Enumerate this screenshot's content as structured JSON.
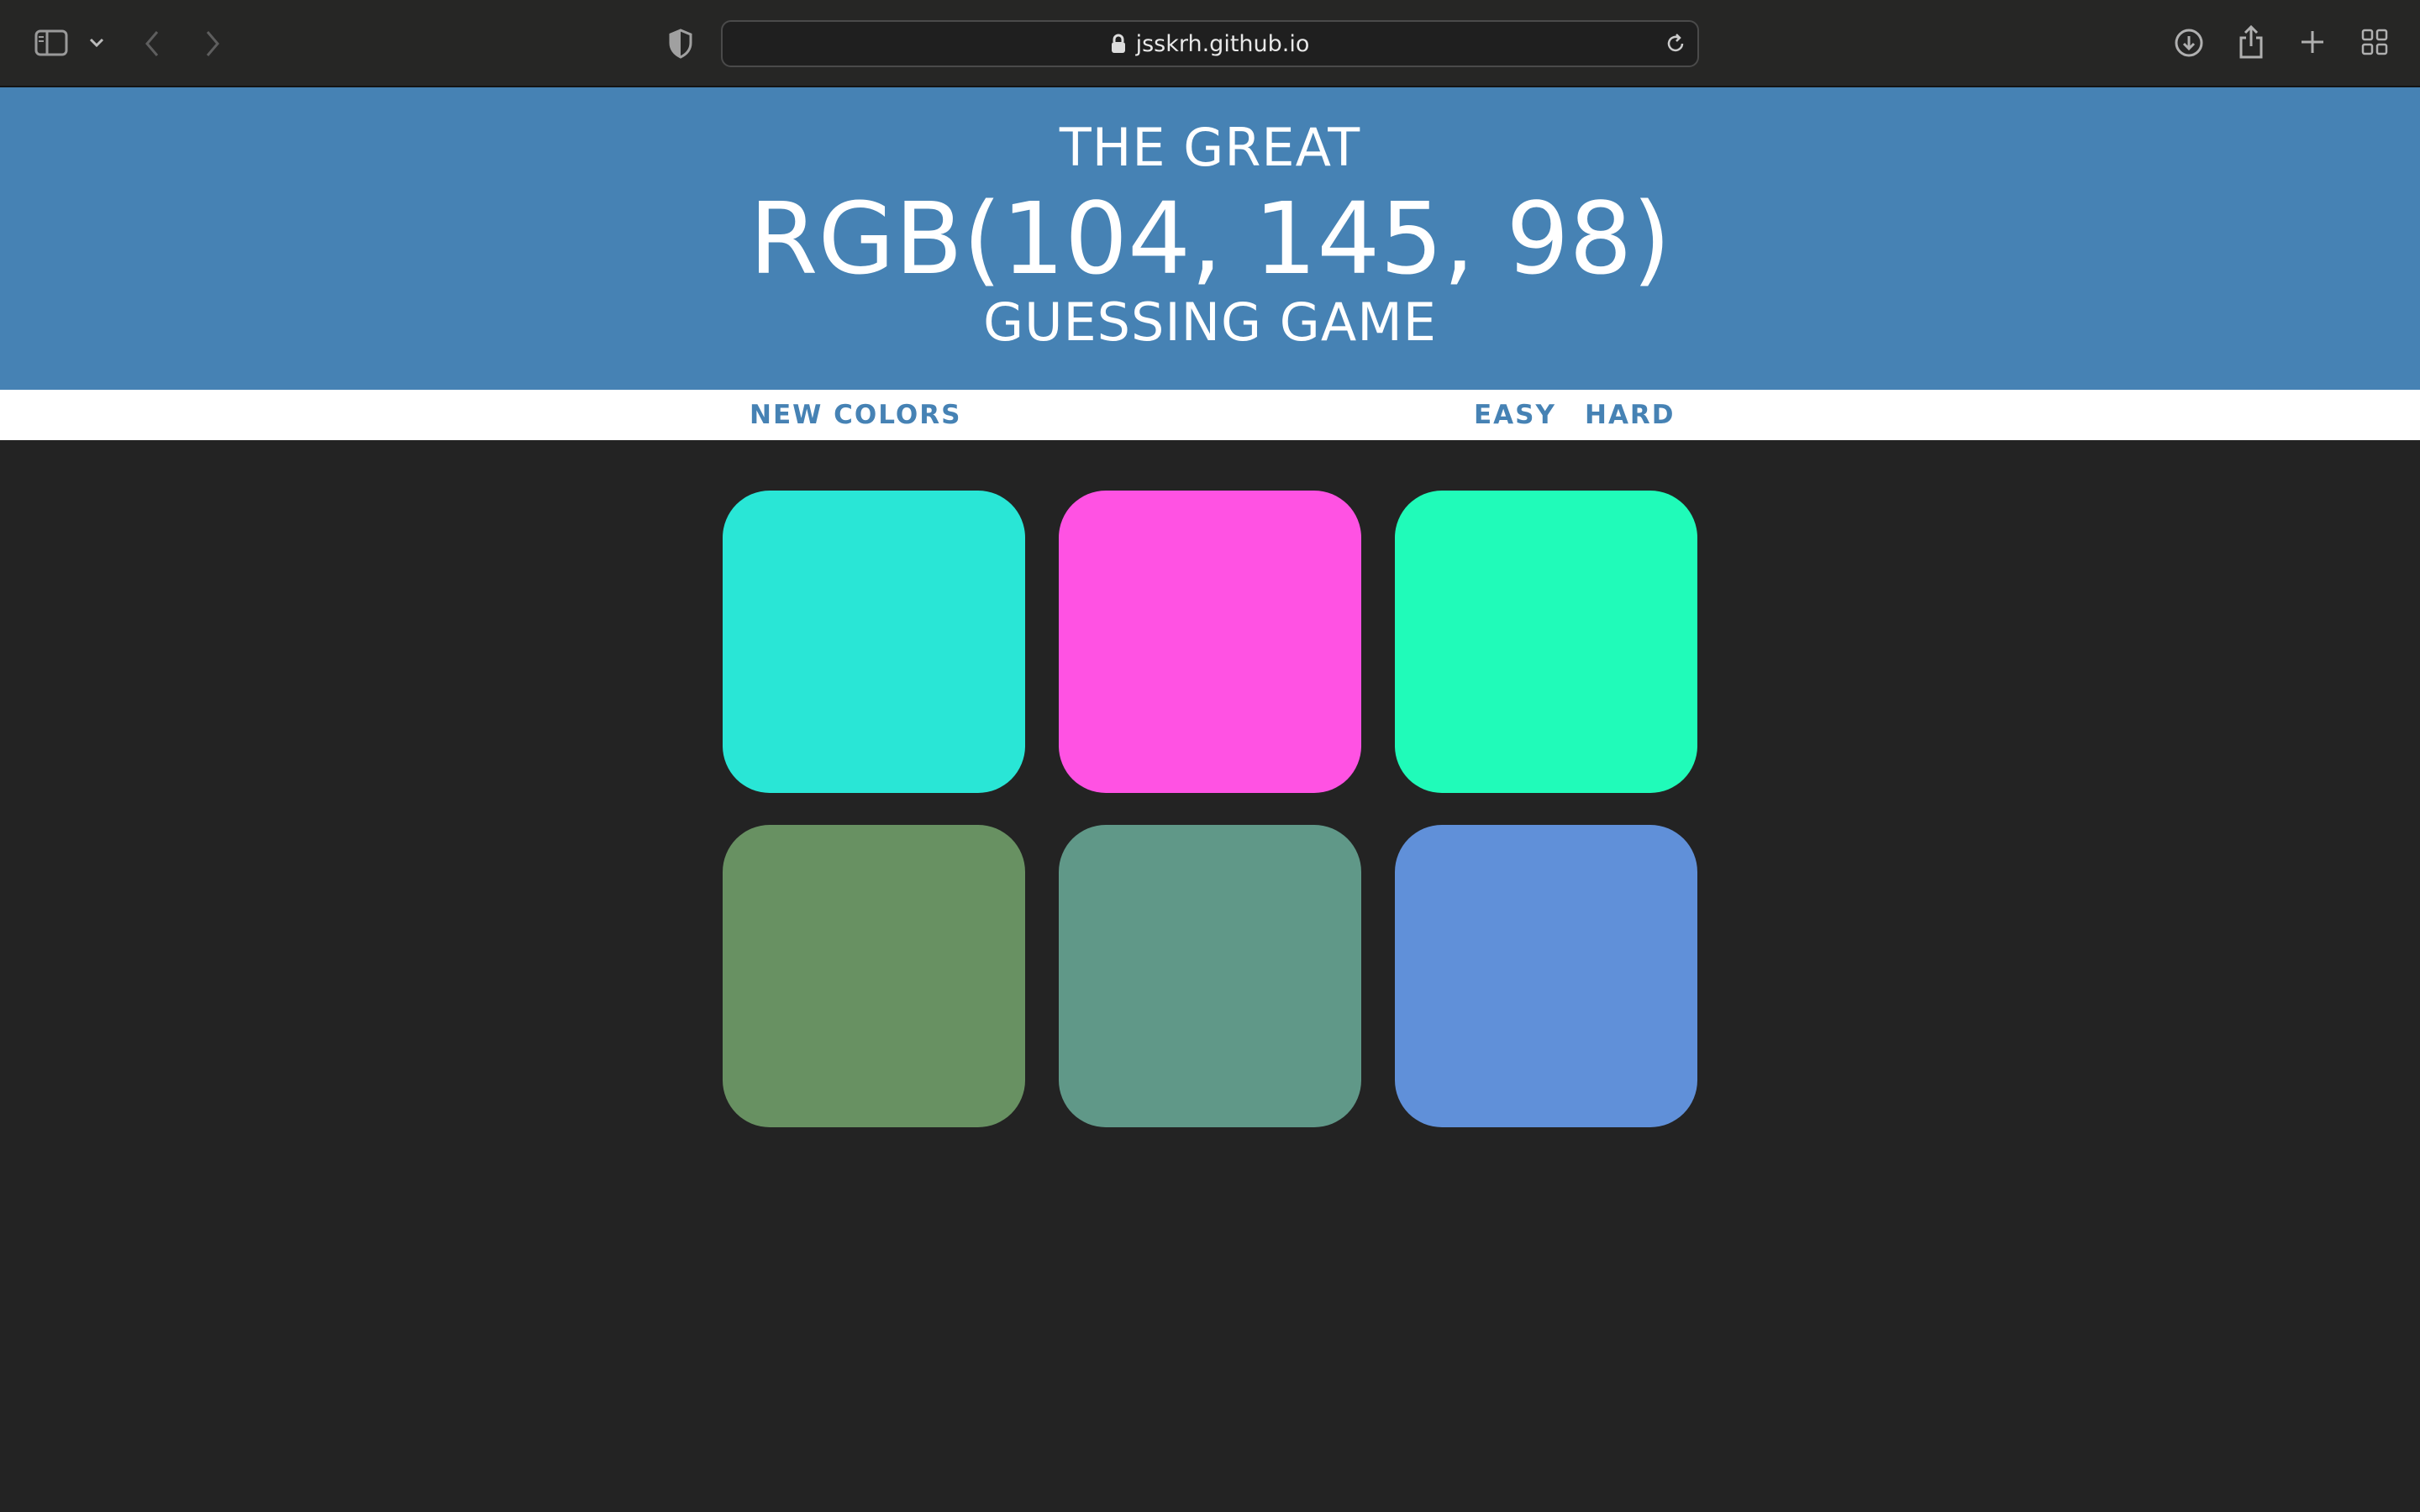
{
  "browser": {
    "url": "jsskrh.github.io",
    "icons": [
      "sidebar-icon",
      "chevron-down-icon",
      "back-icon",
      "forward-icon",
      "shield-icon",
      "lock-icon",
      "reload-icon",
      "download-icon",
      "share-icon",
      "plus-icon",
      "tab-overview-icon"
    ]
  },
  "header": {
    "line1": "THE GREAT",
    "color_display": "RGB(104, 145, 98)",
    "line3": "GUESSING GAME",
    "background": "#4682b4"
  },
  "controls": {
    "new_colors_label": "NEW COLORS",
    "message": "",
    "easy_label": "EASY",
    "hard_label": "HARD",
    "accent": "#4682b4"
  },
  "squares": [
    {
      "color": "#29e6d6"
    },
    {
      "color": "#ff52e3"
    },
    {
      "color": "#20fbb9"
    },
    {
      "color": "#689162"
    },
    {
      "color": "#609888"
    },
    {
      "color": "#6090d9"
    }
  ],
  "page_background": "#232323"
}
